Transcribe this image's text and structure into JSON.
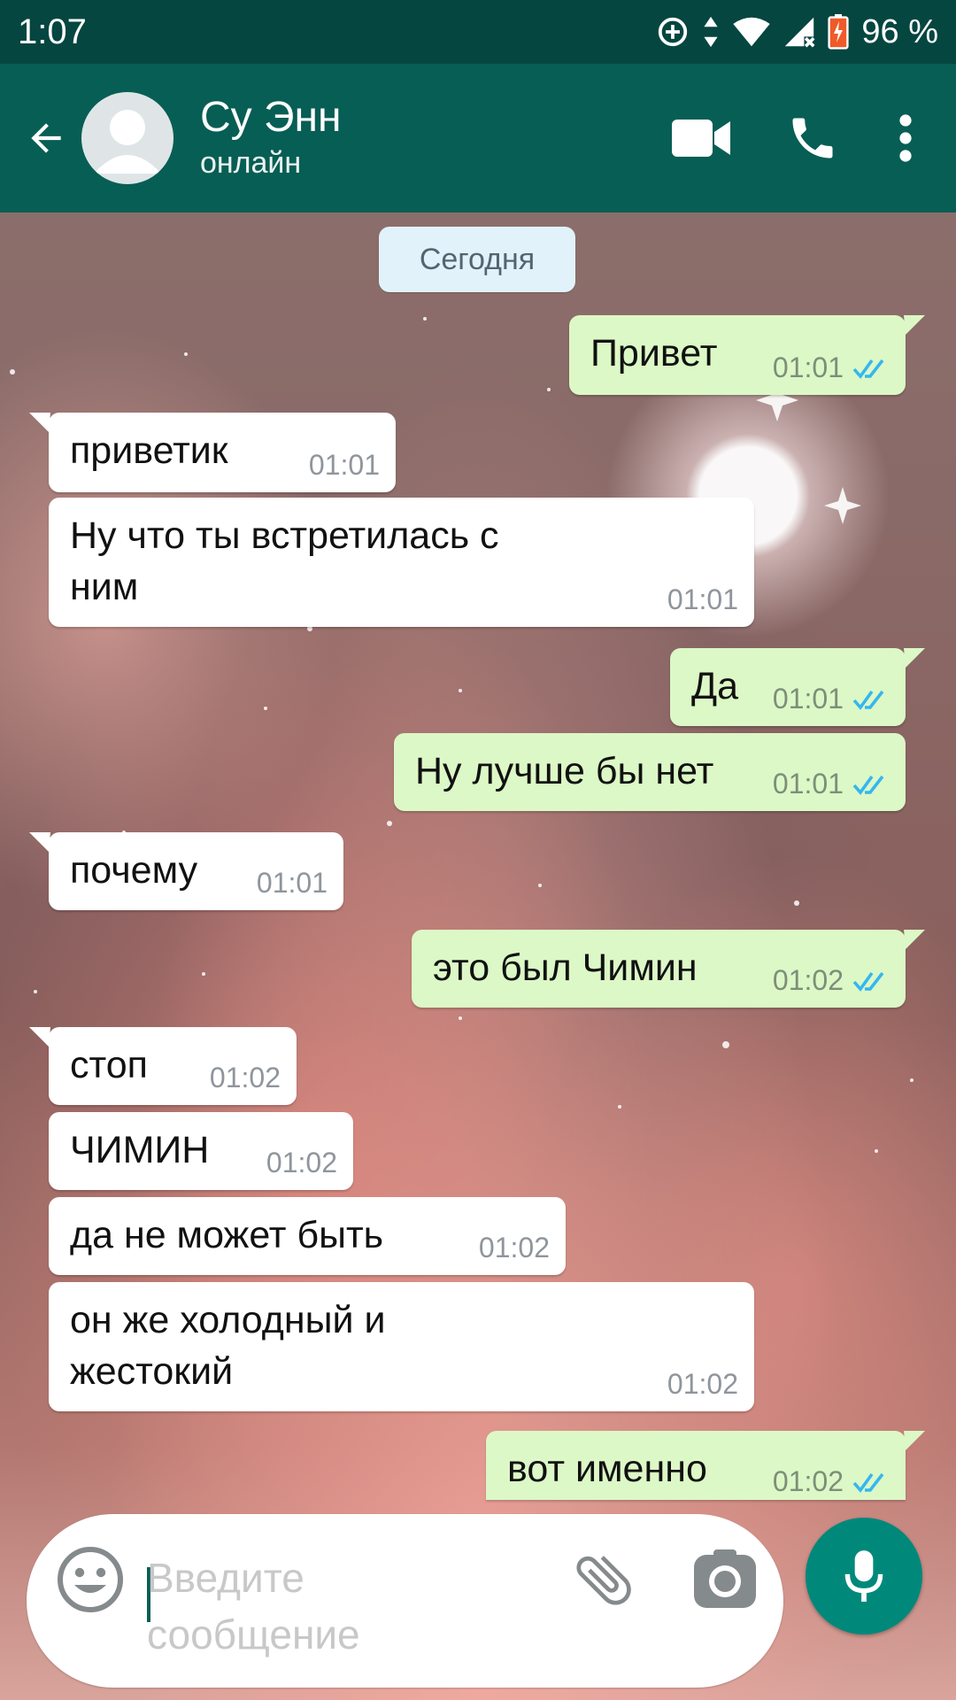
{
  "status_bar": {
    "time": "1:07",
    "battery": "96 %"
  },
  "header": {
    "contact_name": "Су Энн",
    "contact_status": "онлайн"
  },
  "date_chip": "Сегодня",
  "messages": [
    {
      "dir": "out",
      "text": "Привет",
      "time": "01:01"
    },
    {
      "dir": "in",
      "text": "приветик",
      "time": "01:01"
    },
    {
      "dir": "in",
      "text": "Ну что ты встретилась с ним",
      "time": "01:01"
    },
    {
      "dir": "out",
      "text": "Да",
      "time": "01:01"
    },
    {
      "dir": "out",
      "text": "Ну лучше бы нет",
      "time": "01:01"
    },
    {
      "dir": "in",
      "text": "почему",
      "time": "01:01"
    },
    {
      "dir": "out",
      "text": "это был Чимин",
      "time": "01:02"
    },
    {
      "dir": "in",
      "text": "стоп",
      "time": "01:02"
    },
    {
      "dir": "in",
      "text": "ЧИМИН",
      "time": "01:02"
    },
    {
      "dir": "in",
      "text": "да не может быть",
      "time": "01:02"
    },
    {
      "dir": "in",
      "text": "он же холодный и жестокий",
      "time": "01:02"
    },
    {
      "dir": "out",
      "text": "вот именно",
      "time": "01:02"
    }
  ],
  "composer": {
    "placeholder": "Введите сообщение"
  },
  "colors": {
    "header": "#075e54",
    "status_bar": "#054640",
    "outgoing_bubble": "#dcf8c6",
    "incoming_bubble": "#ffffff",
    "read_ticks": "#34b7f1",
    "mic_button": "#00897b"
  },
  "icons": [
    "back-arrow-icon",
    "video-call-icon",
    "phone-icon",
    "more-vert-icon",
    "emoji-icon",
    "attach-icon",
    "camera-icon",
    "mic-icon"
  ]
}
